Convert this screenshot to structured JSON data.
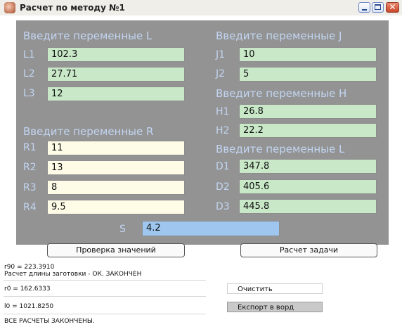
{
  "window": {
    "title": "Расчет по методу №1",
    "close_glyph": "✕"
  },
  "groups": {
    "l_header": "Введите переменные L",
    "j_header": "Введите переменные J",
    "h_header": "Введите переменные H",
    "r_header": "Введите переменные R",
    "d_header": "Введите переменные L"
  },
  "fields": {
    "L1": {
      "label": "L1",
      "value": "102.3"
    },
    "L2": {
      "label": "L2",
      "value": "27.71"
    },
    "L3": {
      "label": "L3",
      "value": "12"
    },
    "J1": {
      "label": "J1",
      "value": "10"
    },
    "J2": {
      "label": "J2",
      "value": "5"
    },
    "H1": {
      "label": "H1",
      "value": "26.8"
    },
    "H2": {
      "label": "H2",
      "value": "22.2"
    },
    "R1": {
      "label": "R1",
      "value": "11"
    },
    "R2": {
      "label": "R2",
      "value": "13"
    },
    "R3": {
      "label": "R3",
      "value": "8"
    },
    "R4": {
      "label": "R4",
      "value": "9.5"
    },
    "D1": {
      "label": "D1",
      "value": "347.8"
    },
    "D2": {
      "label": "D2",
      "value": "405.6"
    },
    "D3": {
      "label": "D3",
      "value": "445.8"
    },
    "S": {
      "label": "S",
      "value": "4.2"
    }
  },
  "buttons": {
    "check": "Проверка значений",
    "calc": "Расчет задачи",
    "clear": "Очистить",
    "export": "Експорт в ворд"
  },
  "log": {
    "r90": "r90 = 223.3910",
    "status1": "Расчет длины заготовки - ОК. ЗАКОНЧЕН",
    "r0": "r0 = 162.6333",
    "l0": "l0 = 1021.8250",
    "final": "ВСЕ РАСЧЕТЫ ЗАКОНЧЕНЫ."
  },
  "colors": {
    "panel": "#939393",
    "label": "#c2d5f2",
    "field_green": "#c8e8c8",
    "field_yellow": "#fefbe6",
    "field_blue": "#9ec6ef"
  }
}
